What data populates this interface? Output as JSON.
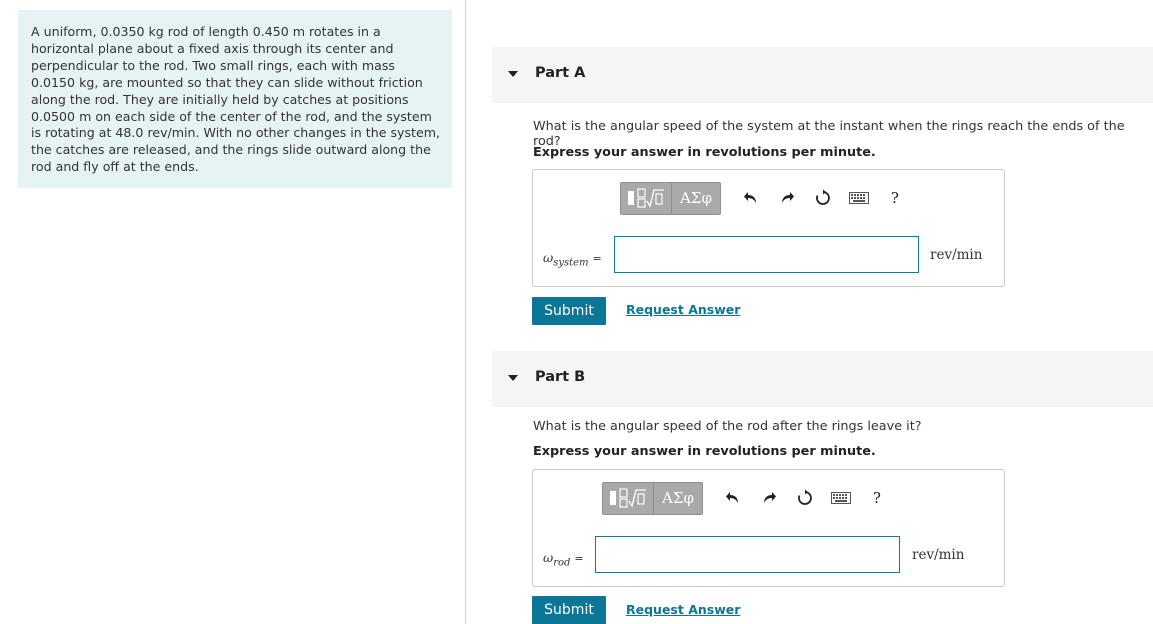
{
  "problem": {
    "text": "A uniform, 0.0350 kg rod of length 0.450 m rotates in a horizontal plane about a fixed axis through its center and perpendicular to the rod. Two small rings, each with mass 0.0150 kg, are mounted so that they can slide without friction along the rod. They are initially held by catches at positions 0.0500 m on each side of the center of the rod, and the system is rotating at 48.0 rev/min. With no other changes in the system, the catches are released, and the rings slide outward along the rod and fly off at the ends."
  },
  "parts": [
    {
      "title": "Part A",
      "question": "What is the angular speed of the system at the instant when the rings reach the ends of the rod?",
      "instruction": "Express your answer in revolutions per minute.",
      "symbol": "ω",
      "subscript": "system",
      "equals": "=",
      "input_value": "",
      "unit": "rev/min",
      "submit_label": "Submit",
      "request_label": "Request Answer"
    },
    {
      "title": "Part B",
      "question": "What is the angular speed of the rod after the rings leave it?",
      "instruction": "Express your answer in revolutions per minute.",
      "symbol": "ω",
      "subscript": "rod",
      "equals": "=",
      "input_value": "",
      "unit": "rev/min",
      "submit_label": "Submit",
      "request_label": "Request Answer"
    }
  ],
  "toolbar": {
    "greek_label": "ΑΣφ",
    "help_label": "?",
    "icons": [
      "templates-icon",
      "greek-symbols-icon",
      "undo-icon",
      "redo-icon",
      "reset-icon",
      "keyboard-icon",
      "help-icon"
    ]
  },
  "colors": {
    "accent": "#0b7695",
    "problem_bg": "#e6f3f5",
    "part_header_bg": "#f5f5f5",
    "toolbar_button": "#a9a9a9"
  }
}
